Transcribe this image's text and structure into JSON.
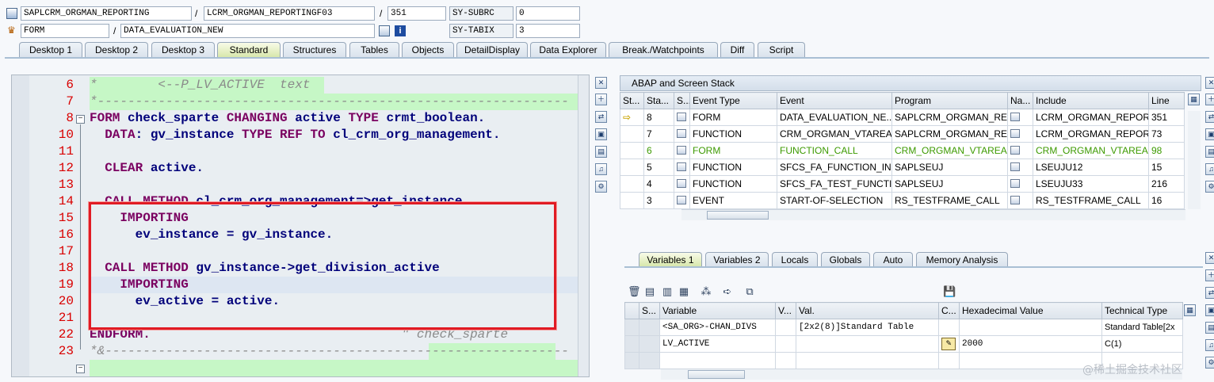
{
  "header": {
    "program": "SAPLCRM_ORGMAN_REPORTING",
    "include": "LCRM_ORGMAN_REPORTINGF03",
    "line": "351",
    "subrc_label": "SY-SUBRC",
    "subrc_value": "0",
    "event_type": "FORM",
    "event_name": "DATA_EVALUATION_NEW",
    "tabix_label": "SY-TABIX",
    "tabix_value": "3"
  },
  "tabs": [
    "Desktop 1",
    "Desktop 2",
    "Desktop 3",
    "Standard",
    "Structures",
    "Tables",
    "Objects",
    "DetailDisplay",
    "Data Explorer",
    "Break./Watchpoints",
    "Diff",
    "Script"
  ],
  "active_tab": "Standard",
  "editor": {
    "line_numbers": [
      "6",
      "7",
      "8",
      "10",
      "11",
      "12",
      "13",
      "14",
      "15",
      "16",
      "17",
      "18",
      "19",
      "20",
      "21",
      "22",
      "23"
    ],
    "lines": [
      {
        "n": "6",
        "segs": [
          {
            "t": "*        <--P_LV_ACTIVE  text",
            "c": "cm"
          }
        ]
      },
      {
        "n": "7",
        "segs": [
          {
            "t": "*--------------------------------------------------------------",
            "c": "cm"
          }
        ]
      },
      {
        "n": "8",
        "segs": [
          {
            "t": "FORM",
            "c": "kw"
          },
          {
            "t": " check_sparte ",
            "c": ""
          },
          {
            "t": "CHANGING",
            "c": "kw"
          },
          {
            "t": " active ",
            "c": ""
          },
          {
            "t": "TYPE",
            "c": "kw"
          },
          {
            "t": " crmt_boolean.",
            "c": ""
          }
        ]
      },
      {
        "n": "10",
        "segs": [
          {
            "t": "  DATA",
            "c": "kw"
          },
          {
            "t": ": gv_instance ",
            "c": ""
          },
          {
            "t": "TYPE REF TO",
            "c": "kw"
          },
          {
            "t": " cl_crm_org_management.",
            "c": ""
          }
        ]
      },
      {
        "n": "11",
        "segs": []
      },
      {
        "n": "12",
        "segs": [
          {
            "t": "  CLEAR",
            "c": "kw"
          },
          {
            "t": " active.",
            "c": ""
          }
        ]
      },
      {
        "n": "13",
        "segs": []
      },
      {
        "n": "14",
        "segs": [
          {
            "t": "  CALL METHOD",
            "c": "kw"
          },
          {
            "t": " cl_crm_org_management=>get_instance",
            "c": ""
          }
        ]
      },
      {
        "n": "15",
        "segs": [
          {
            "t": "    IMPORTING",
            "c": "kw"
          }
        ]
      },
      {
        "n": "16",
        "segs": [
          {
            "t": "      ev_instance = gv_instance.",
            "c": ""
          }
        ]
      },
      {
        "n": "17",
        "segs": []
      },
      {
        "n": "18",
        "segs": [
          {
            "t": "  CALL METHOD",
            "c": "kw"
          },
          {
            "t": " gv_instance->get_division_active",
            "c": ""
          }
        ]
      },
      {
        "n": "19",
        "segs": [
          {
            "t": "    IMPORTING",
            "c": "kw"
          }
        ]
      },
      {
        "n": "20",
        "segs": [
          {
            "t": "      ev_active = active.",
            "c": ""
          }
        ]
      },
      {
        "n": "21",
        "segs": []
      },
      {
        "n": "22",
        "segs": [
          {
            "t": "ENDFORM.",
            "c": "kw"
          },
          {
            "t": "                                 \" check_sparte",
            "c": "cm"
          }
        ]
      },
      {
        "n": "23",
        "segs": [
          {
            "t": "*&-------------------------------------------------------------",
            "c": "cm"
          }
        ]
      }
    ]
  },
  "stack": {
    "title": "ABAP and Screen Stack",
    "columns": [
      "St...",
      "Sta...",
      "S...",
      "Event Type",
      "Event",
      "Program",
      "Na...",
      "Include",
      "Line"
    ],
    "rows": [
      {
        "st": "arrow",
        "sta": "8",
        "type": "FORM",
        "event": "DATA_EVALUATION_NE...",
        "program": "SAPLCRM_ORGMAN_REP...",
        "include": "LCRM_ORGMAN_REPORT...",
        "line": "351"
      },
      {
        "st": "",
        "sta": "7",
        "type": "FUNCTION",
        "event": "CRM_ORGMAN_VTAREA...",
        "program": "SAPLCRM_ORGMAN_REP...",
        "include": "LCRM_ORGMAN_REPORT...",
        "line": "73"
      },
      {
        "st": "",
        "sta": "6",
        "type": "FORM",
        "event": "FUNCTION_CALL",
        "program": "CRM_ORGMAN_VTAREA...",
        "include": "CRM_ORGMAN_VTAREA...",
        "line": "98",
        "grey": true
      },
      {
        "st": "",
        "sta": "5",
        "type": "FUNCTION",
        "event": "SFCS_FA_FUNCTION_IN...",
        "program": "SAPLSEUJ",
        "include": "LSEUJU12",
        "line": "15"
      },
      {
        "st": "",
        "sta": "4",
        "type": "FUNCTION",
        "event": "SFCS_FA_TEST_FUNCTI...",
        "program": "SAPLSEUJ",
        "include": "LSEUJU33",
        "line": "216"
      },
      {
        "st": "",
        "sta": "3",
        "type": "EVENT",
        "event": "START-OF-SELECTION",
        "program": "RS_TESTFRAME_CALL",
        "include": "RS_TESTFRAME_CALL",
        "line": "16"
      }
    ]
  },
  "vars_tabs": [
    "Variables 1",
    "Variables 2",
    "Locals",
    "Globals",
    "Auto",
    "Memory Analysis"
  ],
  "vars": {
    "columns": [
      "S...",
      "Variable",
      "V...",
      "Val.",
      "C...",
      "Hexadecimal Value",
      "Technical Type"
    ],
    "rows": [
      {
        "variable": "<SA_ORG>-CHAN_DIVS",
        "value": "[2x2(8)]Standard Table",
        "hex": "",
        "type": "Standard Table[2x"
      },
      {
        "variable": "LV_ACTIVE",
        "value": "",
        "hex": "2000",
        "type": "C(1)"
      }
    ]
  },
  "watermark": "@稀土掘金技术社区"
}
